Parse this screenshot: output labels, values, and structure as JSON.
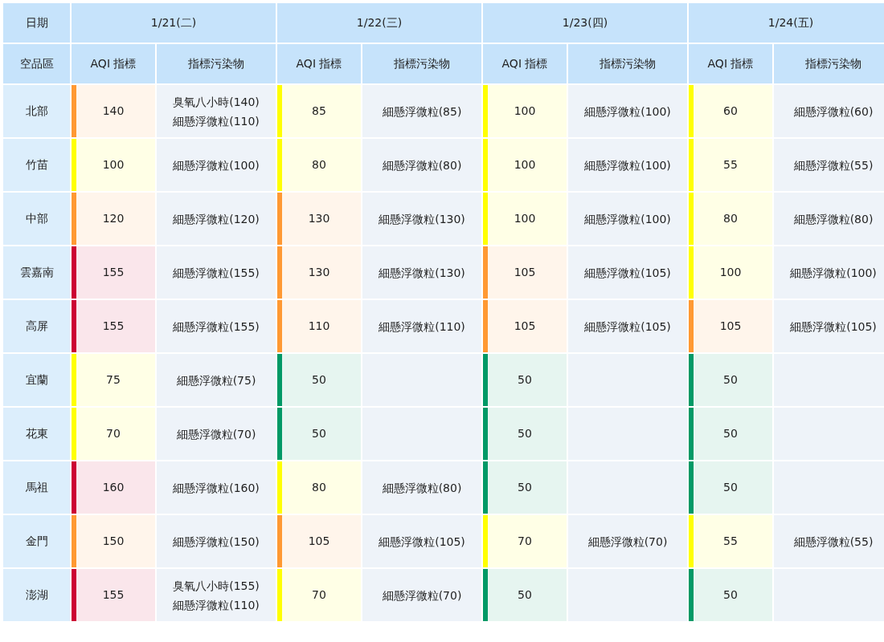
{
  "corner_header": "日期",
  "region_header": "空品區",
  "days": [
    {
      "date": "1/21(二)",
      "aqi_header": "AQI 指標",
      "pollutant_header": "指標污染物"
    },
    {
      "date": "1/22(三)",
      "aqi_header": "AQI 指標",
      "pollutant_header": "指標污染物"
    },
    {
      "date": "1/23(四)",
      "aqi_header": "AQI 指標",
      "pollutant_header": "指標污染物"
    },
    {
      "date": "1/24(五)",
      "aqi_header": "AQI 指標",
      "pollutant_header": "指標污染物"
    }
  ],
  "rows": [
    {
      "region": "北部",
      "forecasts": [
        {
          "aqi": "140",
          "color": "#ff9933",
          "pollutants": [
            "臭氧八小時(140)",
            "細懸浮微粒(110)"
          ]
        },
        {
          "aqi": "85",
          "color": "#ffff00",
          "pollutants": [
            "細懸浮微粒(85)"
          ]
        },
        {
          "aqi": "100",
          "color": "#ffff00",
          "pollutants": [
            "細懸浮微粒(100)"
          ]
        },
        {
          "aqi": "60",
          "color": "#ffff00",
          "pollutants": [
            "細懸浮微粒(60)"
          ]
        }
      ]
    },
    {
      "region": "竹苗",
      "forecasts": [
        {
          "aqi": "100",
          "color": "#ffff00",
          "pollutants": [
            "細懸浮微粒(100)"
          ]
        },
        {
          "aqi": "80",
          "color": "#ffff00",
          "pollutants": [
            "細懸浮微粒(80)"
          ]
        },
        {
          "aqi": "100",
          "color": "#ffff00",
          "pollutants": [
            "細懸浮微粒(100)"
          ]
        },
        {
          "aqi": "55",
          "color": "#ffff00",
          "pollutants": [
            "細懸浮微粒(55)"
          ]
        }
      ]
    },
    {
      "region": "中部",
      "forecasts": [
        {
          "aqi": "120",
          "color": "#ff9933",
          "pollutants": [
            "細懸浮微粒(120)"
          ]
        },
        {
          "aqi": "130",
          "color": "#ff9933",
          "pollutants": [
            "細懸浮微粒(130)"
          ]
        },
        {
          "aqi": "100",
          "color": "#ffff00",
          "pollutants": [
            "細懸浮微粒(100)"
          ]
        },
        {
          "aqi": "80",
          "color": "#ffff00",
          "pollutants": [
            "細懸浮微粒(80)"
          ]
        }
      ]
    },
    {
      "region": "雲嘉南",
      "forecasts": [
        {
          "aqi": "155",
          "color": "#cc0033",
          "pollutants": [
            "細懸浮微粒(155)"
          ]
        },
        {
          "aqi": "130",
          "color": "#ff9933",
          "pollutants": [
            "細懸浮微粒(130)"
          ]
        },
        {
          "aqi": "105",
          "color": "#ff9933",
          "pollutants": [
            "細懸浮微粒(105)"
          ]
        },
        {
          "aqi": "100",
          "color": "#ffff00",
          "pollutants": [
            "細懸浮微粒(100)"
          ]
        }
      ]
    },
    {
      "region": "高屏",
      "forecasts": [
        {
          "aqi": "155",
          "color": "#cc0033",
          "pollutants": [
            "細懸浮微粒(155)"
          ]
        },
        {
          "aqi": "110",
          "color": "#ff9933",
          "pollutants": [
            "細懸浮微粒(110)"
          ]
        },
        {
          "aqi": "105",
          "color": "#ff9933",
          "pollutants": [
            "細懸浮微粒(105)"
          ]
        },
        {
          "aqi": "105",
          "color": "#ff9933",
          "pollutants": [
            "細懸浮微粒(105)"
          ]
        }
      ]
    },
    {
      "region": "宜蘭",
      "forecasts": [
        {
          "aqi": "75",
          "color": "#ffff00",
          "pollutants": [
            "細懸浮微粒(75)"
          ]
        },
        {
          "aqi": "50",
          "color": "#009966"
        },
        {
          "aqi": "50",
          "color": "#009966"
        },
        {
          "aqi": "50",
          "color": "#009966"
        }
      ]
    },
    {
      "region": "花東",
      "forecasts": [
        {
          "aqi": "70",
          "color": "#ffff00",
          "pollutants": [
            "細懸浮微粒(70)"
          ]
        },
        {
          "aqi": "50",
          "color": "#009966"
        },
        {
          "aqi": "50",
          "color": "#009966"
        },
        {
          "aqi": "50",
          "color": "#009966"
        }
      ]
    },
    {
      "region": "馬祖",
      "forecasts": [
        {
          "aqi": "160",
          "color": "#cc0033",
          "pollutants": [
            "細懸浮微粒(160)"
          ]
        },
        {
          "aqi": "80",
          "color": "#ffff00",
          "pollutants": [
            "細懸浮微粒(80)"
          ]
        },
        {
          "aqi": "50",
          "color": "#009966"
        },
        {
          "aqi": "50",
          "color": "#009966"
        }
      ]
    },
    {
      "region": "金門",
      "forecasts": [
        {
          "aqi": "150",
          "color": "#ff9933",
          "pollutants": [
            "細懸浮微粒(150)"
          ]
        },
        {
          "aqi": "105",
          "color": "#ff9933",
          "pollutants": [
            "細懸浮微粒(105)"
          ]
        },
        {
          "aqi": "70",
          "color": "#ffff00",
          "pollutants": [
            "細懸浮微粒(70)"
          ]
        },
        {
          "aqi": "55",
          "color": "#ffff00",
          "pollutants": [
            "細懸浮微粒(55)"
          ]
        }
      ]
    },
    {
      "region": "澎湖",
      "forecasts": [
        {
          "aqi": "155",
          "color": "#cc0033",
          "pollutants": [
            "臭氧八小時(155)",
            "細懸浮微粒(110)"
          ]
        },
        {
          "aqi": "70",
          "color": "#ffff00",
          "pollutants": [
            "細懸浮微粒(70)"
          ]
        },
        {
          "aqi": "50",
          "color": "#009966"
        },
        {
          "aqi": "50",
          "color": "#009966"
        }
      ]
    }
  ]
}
